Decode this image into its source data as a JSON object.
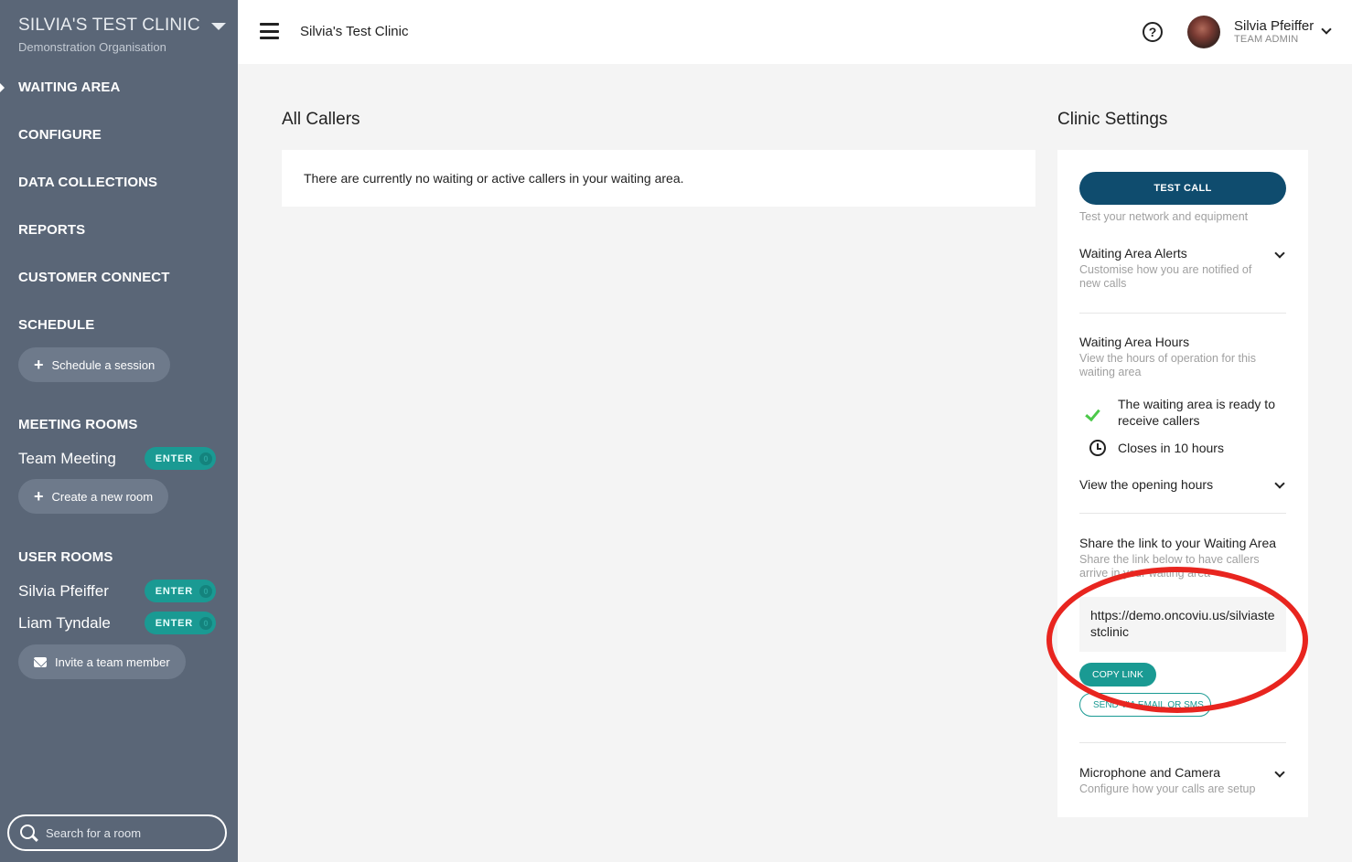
{
  "org": {
    "name": "SILVIA'S TEST CLINIC",
    "subtitle": "Demonstration Organisation"
  },
  "nav": {
    "waiting_area": "WAITING AREA",
    "configure": "CONFIGURE",
    "data_collections": "DATA COLLECTIONS",
    "reports": "REPORTS",
    "customer_connect": "CUSTOMER CONNECT",
    "schedule": "SCHEDULE",
    "schedule_session": "Schedule a session",
    "meeting_rooms": "MEETING ROOMS",
    "user_rooms": "USER ROOMS",
    "create_room": "Create a new room",
    "invite_member": "Invite a team member"
  },
  "meeting_rooms": [
    {
      "name": "Team Meeting",
      "enter": "ENTER",
      "count": "0"
    }
  ],
  "user_rooms": [
    {
      "name": "Silvia Pfeiffer",
      "enter": "ENTER",
      "count": "0"
    },
    {
      "name": "Liam Tyndale",
      "enter": "ENTER",
      "count": "0"
    }
  ],
  "search": {
    "placeholder": "Search for a room"
  },
  "topbar": {
    "clinic_title": "Silvia's Test Clinic",
    "help": "?",
    "user_name": "Silvia Pfeiffer",
    "user_role": "TEAM ADMIN"
  },
  "callers": {
    "title": "All Callers",
    "empty": "There are currently no waiting or active callers in your waiting area."
  },
  "settings": {
    "title": "Clinic Settings",
    "test_call": "TEST CALL",
    "test_call_desc": "Test your network and equipment",
    "alerts_title": "Waiting Area Alerts",
    "alerts_desc": "Customise how you are notified of new calls",
    "hours_title": "Waiting Area Hours",
    "hours_desc": "View the hours of operation for this waiting area",
    "ready_status": "The waiting area is ready to receive callers",
    "closes_status": "Closes in 10 hours",
    "opening_hours": "View the opening hours",
    "share_title": "Share the link to your Waiting Area",
    "share_desc": "Share the link below to have callers arrive in your waiting area",
    "link": "https://demo.oncoviu.us/silviastestclinic",
    "copy_link": "COPY LINK",
    "send": "SEND VIA EMAIL OR SMS",
    "mic_title": "Microphone and Camera",
    "mic_desc": "Configure how your calls are setup"
  },
  "colors": {
    "sidebar": "#5a6677",
    "accent_teal": "#1a9a93",
    "test_call": "#0f4c6e",
    "annotation": "#e8251f"
  }
}
